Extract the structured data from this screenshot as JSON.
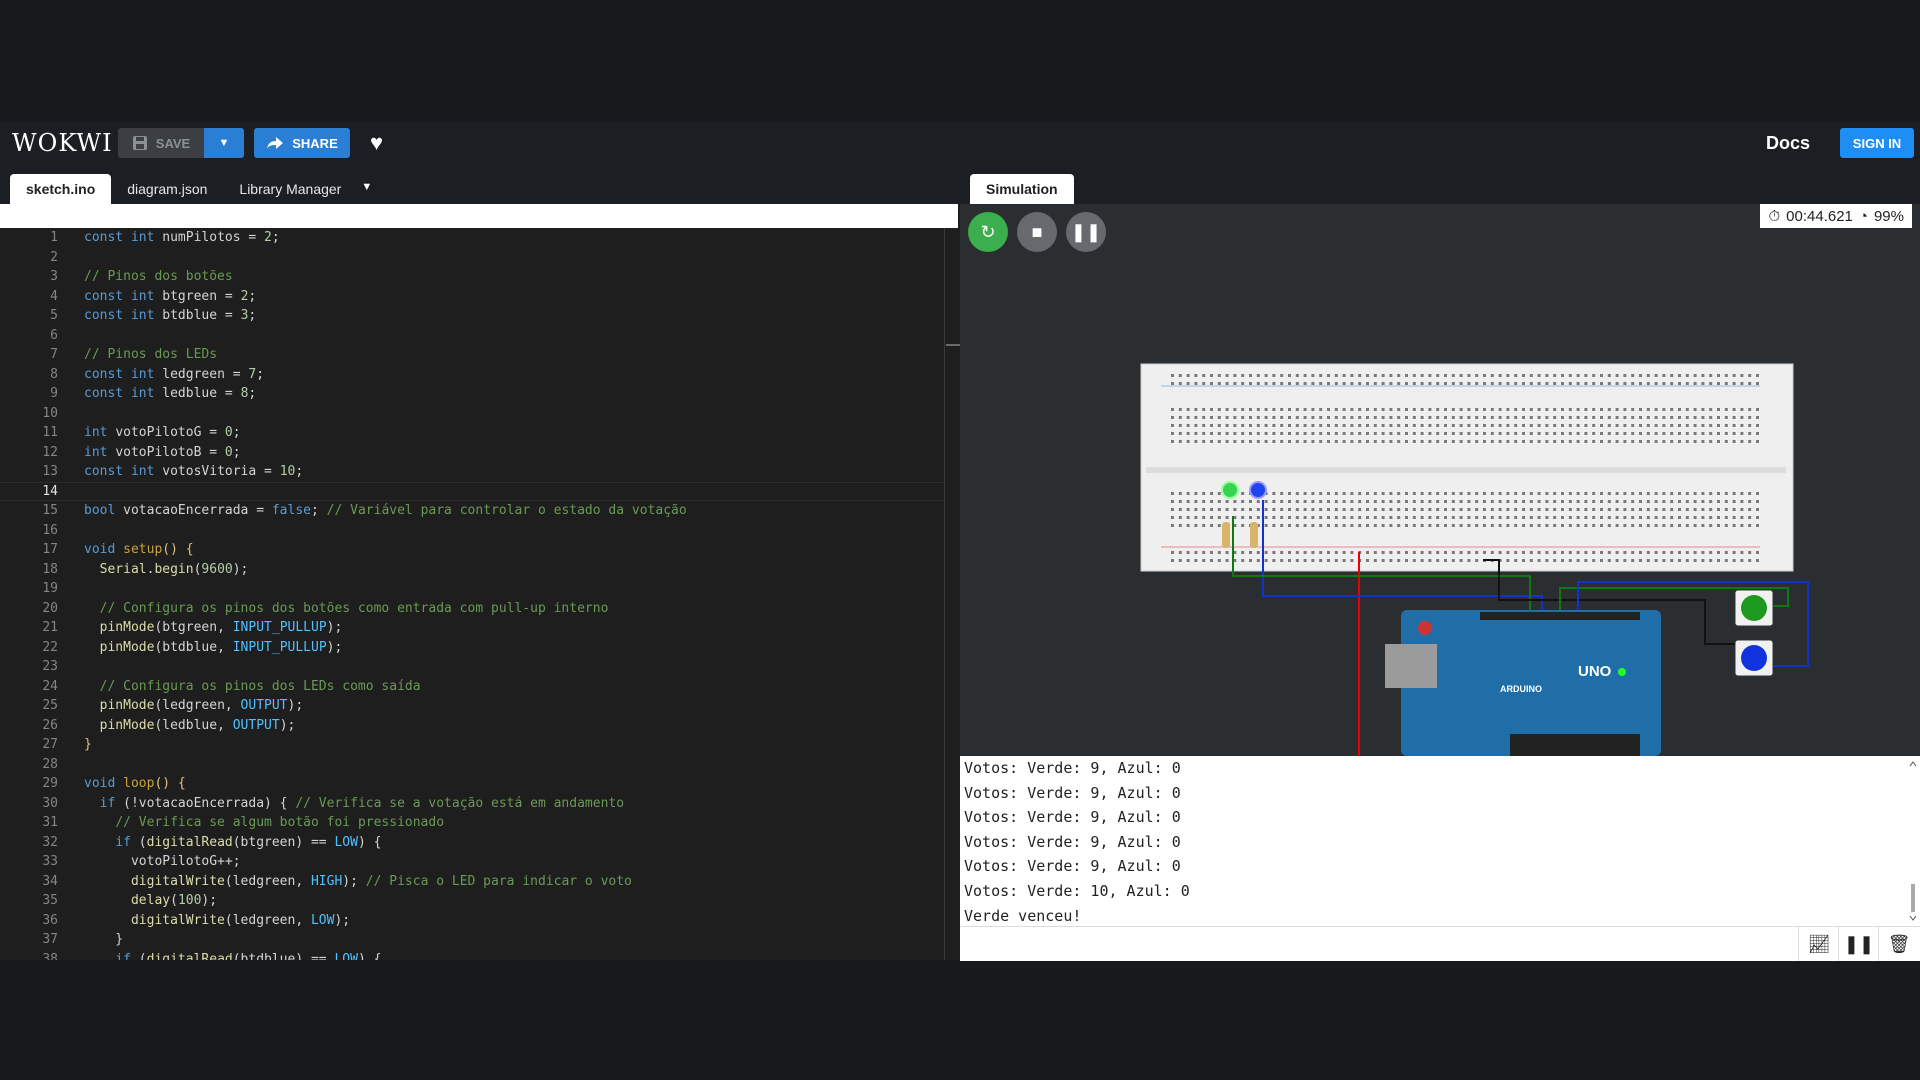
{
  "header": {
    "logo": "WOKWI",
    "save_label": "SAVE",
    "share_label": "SHARE",
    "docs_label": "Docs",
    "signin_label": "SIGN IN"
  },
  "editor": {
    "tabs": [
      "sketch.ino",
      "diagram.json",
      "Library Manager"
    ],
    "active_line": 14,
    "lines": [
      [
        [
          "kw",
          "const "
        ],
        [
          "ty",
          "int "
        ],
        [
          "id",
          "numPilotos = "
        ],
        [
          "nm",
          "2"
        ],
        [
          "p",
          ";"
        ]
      ],
      [],
      [
        [
          "cm",
          "// Pinos dos botões"
        ]
      ],
      [
        [
          "kw",
          "const "
        ],
        [
          "ty",
          "int "
        ],
        [
          "id",
          "btgreen = "
        ],
        [
          "nm",
          "2"
        ],
        [
          "p",
          ";"
        ]
      ],
      [
        [
          "kw",
          "const "
        ],
        [
          "ty",
          "int "
        ],
        [
          "id",
          "btdblue = "
        ],
        [
          "nm",
          "3"
        ],
        [
          "p",
          ";"
        ]
      ],
      [],
      [
        [
          "cm",
          "// Pinos dos LEDs"
        ]
      ],
      [
        [
          "kw",
          "const "
        ],
        [
          "ty",
          "int "
        ],
        [
          "id",
          "ledgreen = "
        ],
        [
          "nm",
          "7"
        ],
        [
          "p",
          ";"
        ]
      ],
      [
        [
          "kw",
          "const "
        ],
        [
          "ty",
          "int "
        ],
        [
          "id",
          "ledblue = "
        ],
        [
          "nm",
          "8"
        ],
        [
          "p",
          ";"
        ]
      ],
      [],
      [
        [
          "ty",
          "int "
        ],
        [
          "id",
          "votoPilotoG = "
        ],
        [
          "nm",
          "0"
        ],
        [
          "p",
          ";"
        ]
      ],
      [
        [
          "ty",
          "int "
        ],
        [
          "id",
          "votoPilotoB = "
        ],
        [
          "nm",
          "0"
        ],
        [
          "p",
          ";"
        ]
      ],
      [
        [
          "kw",
          "const "
        ],
        [
          "ty",
          "int "
        ],
        [
          "id",
          "votosVitoria = "
        ],
        [
          "nm",
          "10"
        ],
        [
          "p",
          ";"
        ]
      ],
      [],
      [
        [
          "ty",
          "bool "
        ],
        [
          "id",
          "votacaoEncerrada = "
        ],
        [
          "kw",
          "false"
        ],
        [
          "p",
          "; "
        ],
        [
          "cm",
          "// Variável para controlar o estado da votação"
        ]
      ],
      [],
      [
        [
          "ty",
          "void "
        ],
        [
          "fn2",
          "setup"
        ],
        [
          "br",
          "() {"
        ]
      ],
      [
        [
          "p",
          "  "
        ],
        [
          "fn",
          "Serial"
        ],
        [
          "p",
          "."
        ],
        [
          "fn",
          "begin"
        ],
        [
          "p",
          "("
        ],
        [
          "nm",
          "9600"
        ],
        [
          "p",
          ");"
        ]
      ],
      [],
      [
        [
          "p",
          "  "
        ],
        [
          "cm",
          "// Configura os pinos dos botões como entrada com pull-up interno"
        ]
      ],
      [
        [
          "p",
          "  "
        ],
        [
          "fn",
          "pinMode"
        ],
        [
          "p",
          "(btgreen, "
        ],
        [
          "cs",
          "INPUT_PULLUP"
        ],
        [
          "p",
          ");"
        ]
      ],
      [
        [
          "p",
          "  "
        ],
        [
          "fn",
          "pinMode"
        ],
        [
          "p",
          "(btdblue, "
        ],
        [
          "cs",
          "INPUT_PULLUP"
        ],
        [
          "p",
          ");"
        ]
      ],
      [],
      [
        [
          "p",
          "  "
        ],
        [
          "cm",
          "// Configura os pinos dos LEDs como saída"
        ]
      ],
      [
        [
          "p",
          "  "
        ],
        [
          "fn",
          "pinMode"
        ],
        [
          "p",
          "(ledgreen, "
        ],
        [
          "cs",
          "OUTPUT"
        ],
        [
          "p",
          ");"
        ]
      ],
      [
        [
          "p",
          "  "
        ],
        [
          "fn",
          "pinMode"
        ],
        [
          "p",
          "(ledblue, "
        ],
        [
          "cs",
          "OUTPUT"
        ],
        [
          "p",
          ");"
        ]
      ],
      [
        [
          "br",
          "}"
        ]
      ],
      [],
      [
        [
          "ty",
          "void "
        ],
        [
          "fn2",
          "loop"
        ],
        [
          "br",
          "() {"
        ]
      ],
      [
        [
          "p",
          "  "
        ],
        [
          "kw",
          "if "
        ],
        [
          "p",
          "(!votacaoEncerrada) { "
        ],
        [
          "cm",
          "// Verifica se a votação está em andamento"
        ]
      ],
      [
        [
          "p",
          "    "
        ],
        [
          "cm",
          "// Verifica se algum botão foi pressionado"
        ]
      ],
      [
        [
          "p",
          "    "
        ],
        [
          "kw",
          "if "
        ],
        [
          "p",
          "("
        ],
        [
          "fn",
          "digitalRead"
        ],
        [
          "p",
          "(btgreen) == "
        ],
        [
          "cs",
          "LOW"
        ],
        [
          "p",
          ") {"
        ]
      ],
      [
        [
          "p",
          "      votoPilotoG++;"
        ]
      ],
      [
        [
          "p",
          "      "
        ],
        [
          "fn",
          "digitalWrite"
        ],
        [
          "p",
          "(ledgreen, "
        ],
        [
          "cs",
          "HIGH"
        ],
        [
          "p",
          "); "
        ],
        [
          "cm",
          "// Pisca o LED para indicar o voto"
        ]
      ],
      [
        [
          "p",
          "      "
        ],
        [
          "fn",
          "delay"
        ],
        [
          "p",
          "("
        ],
        [
          "nm",
          "100"
        ],
        [
          "p",
          ");"
        ]
      ],
      [
        [
          "p",
          "      "
        ],
        [
          "fn",
          "digitalWrite"
        ],
        [
          "p",
          "(ledgreen, "
        ],
        [
          "cs",
          "LOW"
        ],
        [
          "p",
          ");"
        ]
      ],
      [
        [
          "p",
          "    }"
        ]
      ],
      [
        [
          "p",
          "    "
        ],
        [
          "kw",
          "if "
        ],
        [
          "p",
          "("
        ],
        [
          "fn",
          "digitalRead"
        ],
        [
          "p",
          "(btdblue) == "
        ],
        [
          "cs",
          "LOW"
        ],
        [
          "p",
          ") {"
        ]
      ]
    ]
  },
  "simulation": {
    "tab_label": "Simulation",
    "timer": "00:44.621",
    "speed": "99%",
    "board_label": "UNO",
    "board_brand": "ARDUINO",
    "serial_lines": [
      "Votos: Verde: 9, Azul: 0",
      "Votos: Verde: 9, Azul: 0",
      "Votos: Verde: 9, Azul: 0",
      "Votos: Verde: 9, Azul: 0",
      "Votos: Verde: 9, Azul: 0",
      "Votos: Verde: 10, Azul: 0",
      "Verde venceu!"
    ]
  },
  "colors": {
    "kw": "#569cd6",
    "ty": "#569cd6",
    "id": "#d4d4d4",
    "nm": "#b5cea8",
    "cm": "#6a9955",
    "fn": "#dcdcaa",
    "fn2": "#c9a23f",
    "cs": "#4fc1ff",
    "p": "#d4d4d4",
    "br": "#e5c07b"
  },
  "icons": [
    "save-icon",
    "chevron-down-icon",
    "share-icon",
    "heart-icon",
    "restart-icon",
    "stop-icon",
    "pause-icon",
    "timer-icon",
    "speed-icon",
    "plotter-icon",
    "trash-icon"
  ]
}
